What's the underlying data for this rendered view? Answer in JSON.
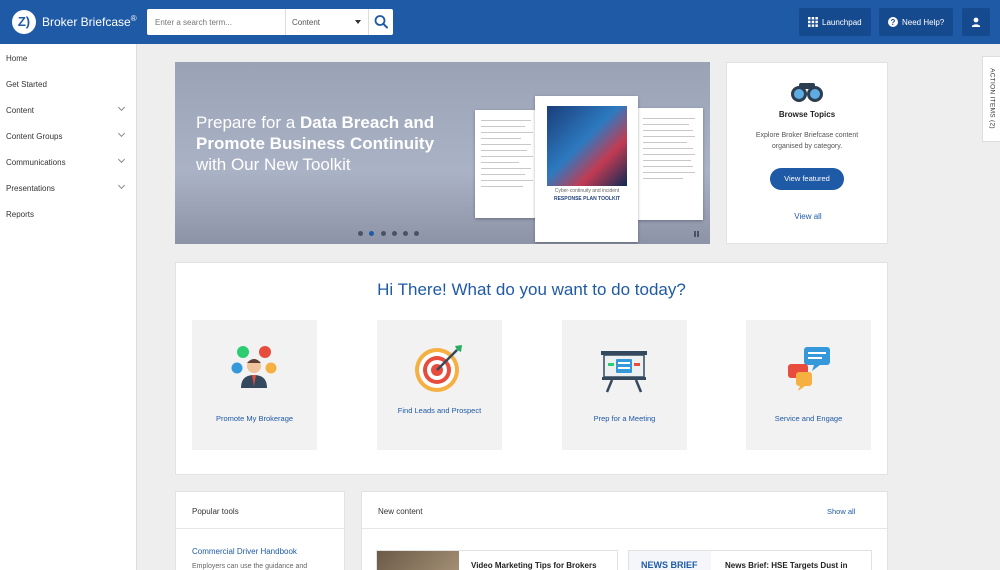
{
  "header": {
    "brand": "Broker Briefcase",
    "brand_mark": "®",
    "logo_text": "Z)",
    "search_placeholder": "Enter a search term...",
    "search_scope": "Content",
    "launchpad_label": "Launchpad",
    "help_label": "Need Help?"
  },
  "sidebar": {
    "items": [
      {
        "label": "Home"
      },
      {
        "label": "Get Started"
      },
      {
        "label": "Content"
      },
      {
        "label": "Content Groups"
      },
      {
        "label": "Communications"
      },
      {
        "label": "Presentations"
      },
      {
        "label": "Reports"
      }
    ]
  },
  "hero": {
    "line1_plain": "Prepare for a ",
    "line1_bold": "Data Breach and",
    "line2_bold": "Promote Business Continuity",
    "line3_plain": "with Our New Toolkit",
    "doc_subtitle": "Cyber-continuity and incident",
    "doc_title": "RESPONSE PLAN TOOLKIT",
    "slide_count": 6,
    "active_slide": 2
  },
  "browse": {
    "title": "Browse Topics",
    "description": "Explore Broker Briefcase content organised by category.",
    "featured_label": "View featured",
    "viewall_label": "View all"
  },
  "greeting": "Hi There! What do you want to do today?",
  "actions": [
    {
      "label": "Promote My Brokerage",
      "icon": "people-network-icon"
    },
    {
      "label": "Find Leads and Prospect",
      "icon": "target-icon"
    },
    {
      "label": "Prep for a Meeting",
      "icon": "presentation-board-icon"
    },
    {
      "label": "Service and Engage",
      "icon": "chat-bubbles-icon"
    }
  ],
  "popular_tools": {
    "title": "Popular tools",
    "item_title": "Commercial Driver Handbook",
    "item_desc": "Employers can use the guidance and"
  },
  "new_content": {
    "title": "New content",
    "show_all": "Show all",
    "items": [
      {
        "title": "Video Marketing Tips for Brokers"
      },
      {
        "badge": "NEWS BRIEF",
        "title": "News Brief: HSE Targets Dust in"
      }
    ]
  },
  "action_items_tab": "ACTION ITEMS (2)",
  "colors": {
    "brand_blue": "#1f5aa6",
    "header_button": "#164a8f"
  }
}
